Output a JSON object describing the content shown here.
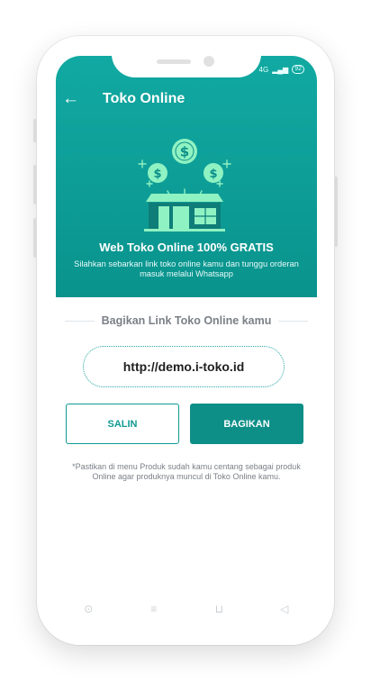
{
  "status": {
    "network": "4G",
    "signal": "▂▄▆",
    "battery": "92"
  },
  "header": {
    "back_icon": "arrow-left-icon",
    "title": "Toko Online"
  },
  "hero": {
    "heading": "Web Toko Online 100% GRATIS",
    "subtitle": "Silahkan sebarkan link toko online kamu dan tunggu orderan masuk melalui Whatsapp",
    "illustration_icon": "store-with-money-icon",
    "colors": {
      "teal_top": "#11a9a2",
      "teal_bottom": "#0a938d",
      "accent_light": "#8ff2c2"
    }
  },
  "share": {
    "title": "Bagikan Link Toko Online kamu",
    "link": "http://demo.i-toko.id"
  },
  "buttons": {
    "copy": "SALIN",
    "share": "BAGIKAN"
  },
  "note": "*Pastikan di menu Produk sudah kamu centang sebagai produk Online agar produknya muncul di Toko Online kamu.",
  "navbar": {
    "items": [
      {
        "icon": "circle-icon",
        "glyph": "⊙"
      },
      {
        "icon": "menu-icon",
        "glyph": "≡"
      },
      {
        "icon": "home-square-icon",
        "glyph": "⊔"
      },
      {
        "icon": "back-triangle-icon",
        "glyph": "◁"
      }
    ]
  }
}
